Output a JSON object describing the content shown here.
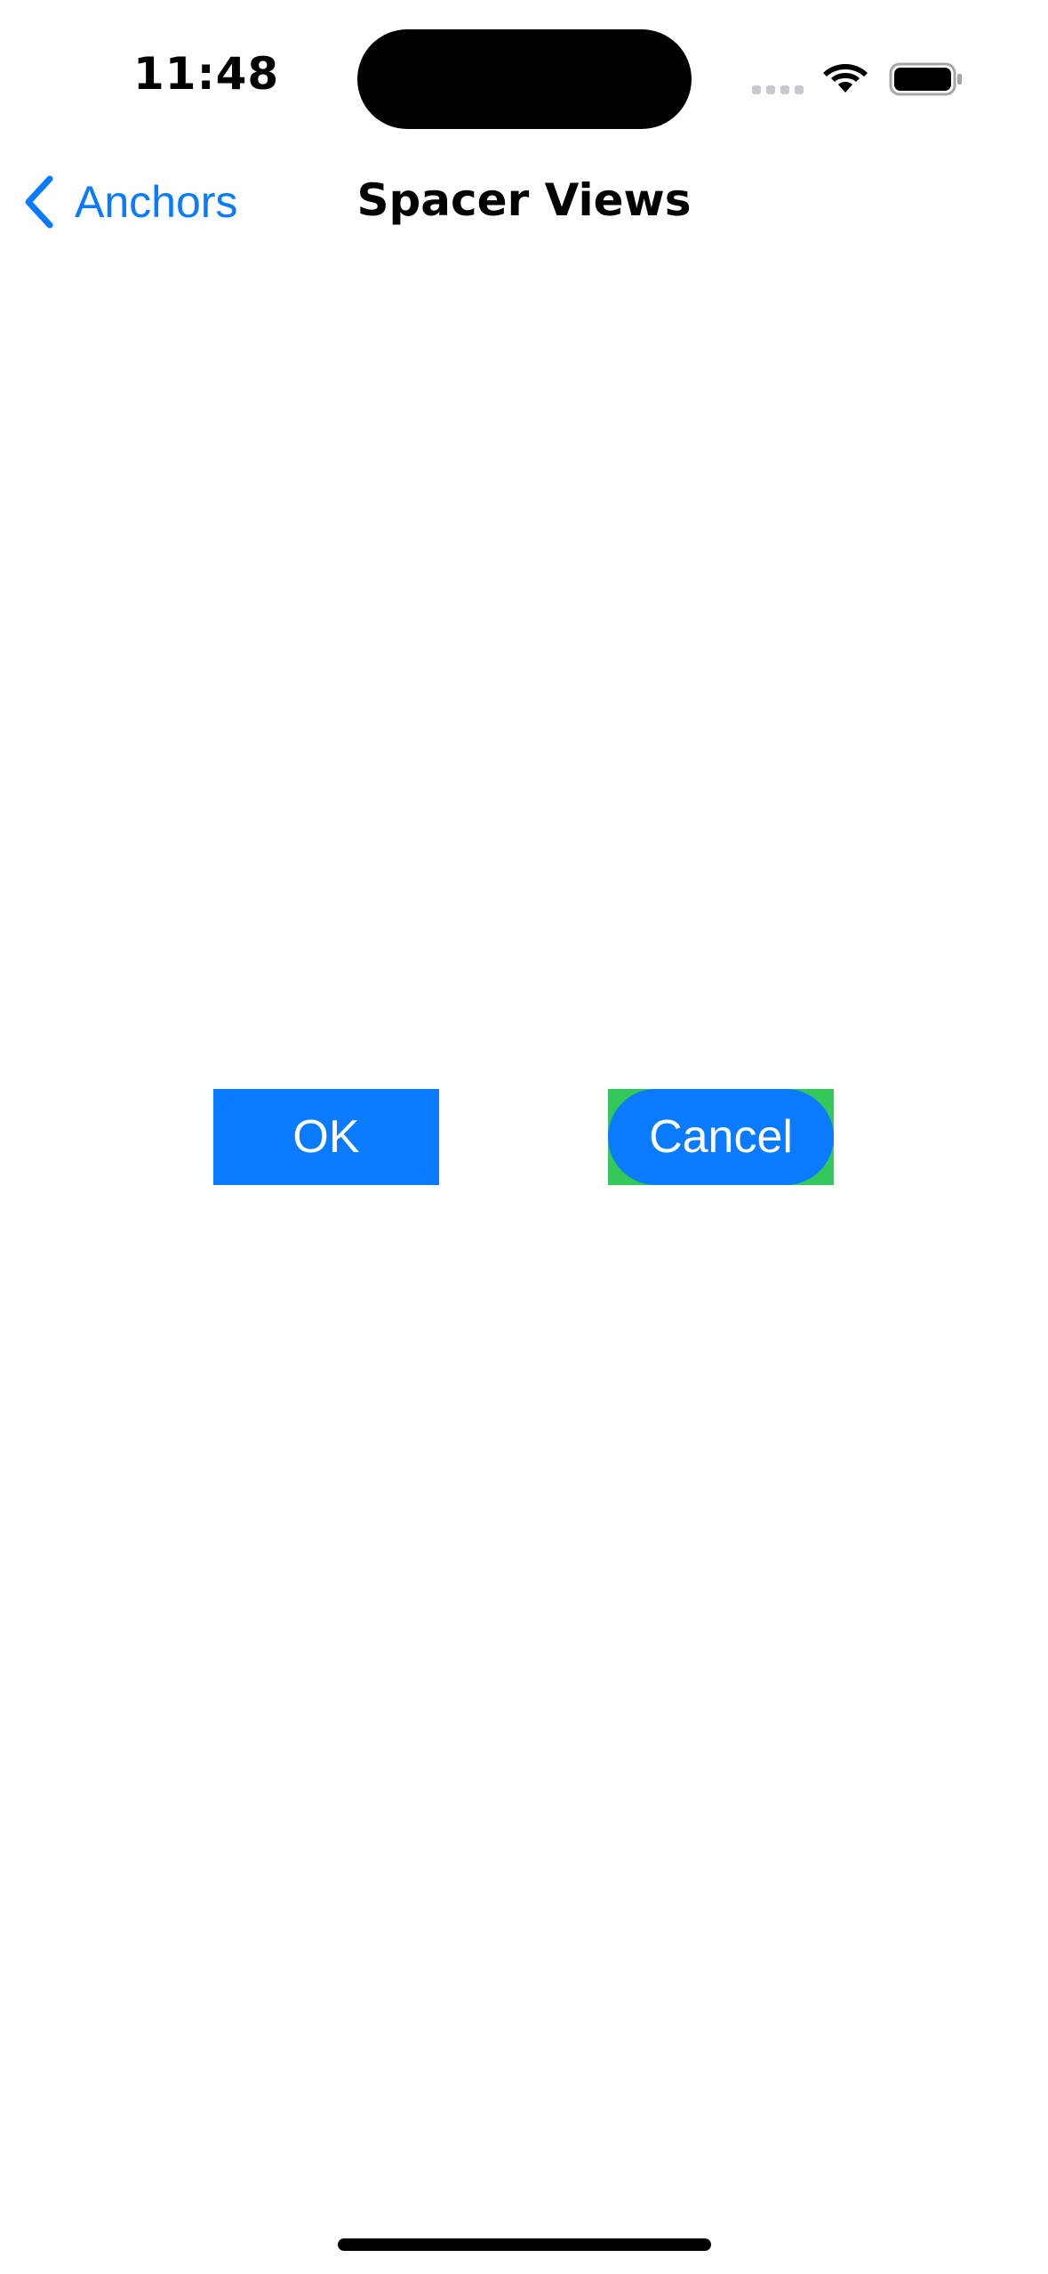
{
  "status_bar": {
    "time": "11:48"
  },
  "nav": {
    "back_label": "Anchors",
    "title": "Spacer Views"
  },
  "buttons": {
    "ok_label": "OK",
    "cancel_label": "Cancel"
  },
  "colors": {
    "accent": "#0a7aff",
    "cancel_background": "#34c759"
  }
}
